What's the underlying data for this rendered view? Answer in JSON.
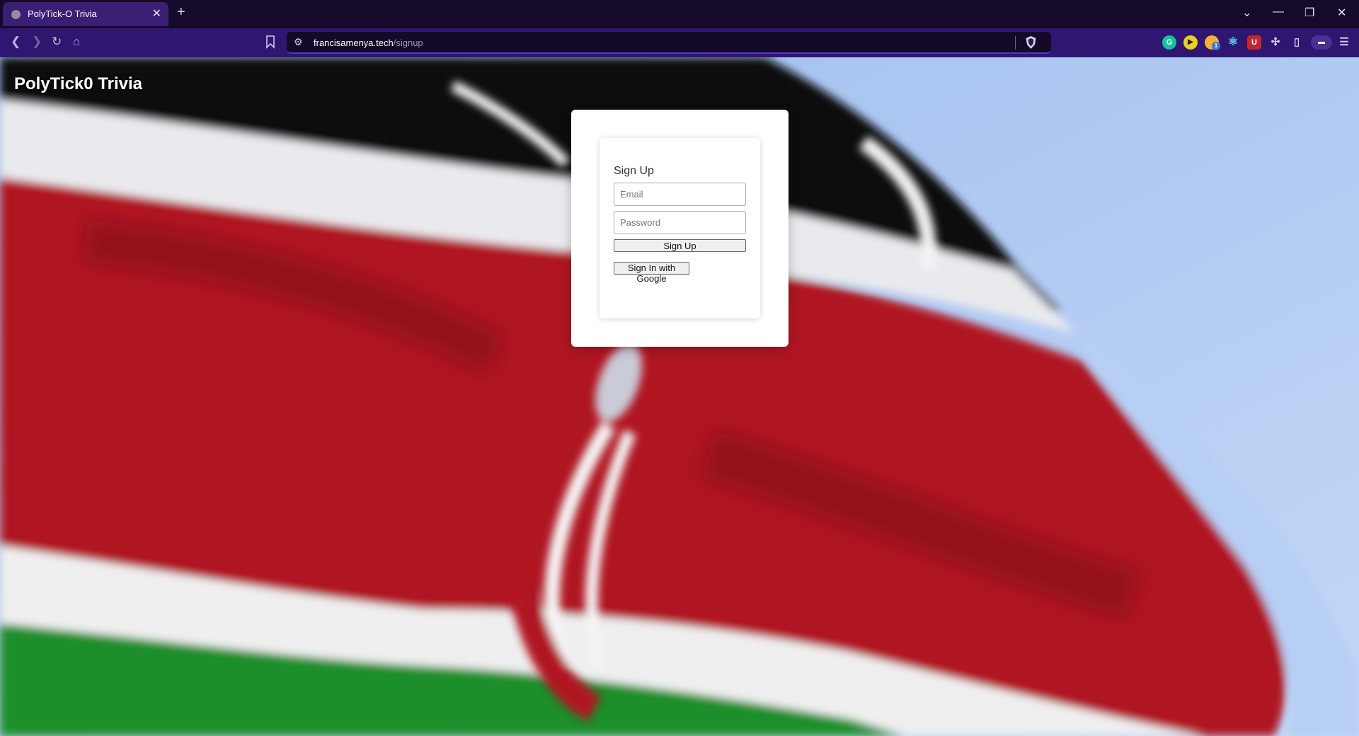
{
  "browser": {
    "tab_title": "PolyTick-O Trivia",
    "url_domain": "francisamenya.tech",
    "url_path": "/signup",
    "extensions": [
      {
        "name": "grammarly-icon",
        "glyph": "G",
        "color": "#15c39a"
      },
      {
        "name": "player-icon",
        "glyph": "▶",
        "color": "#e8d21d"
      },
      {
        "name": "notification-extension-icon",
        "glyph": "",
        "color": "#f2b233",
        "badge": "1"
      },
      {
        "name": "react-devtools-icon",
        "glyph": "⚛",
        "color": "transparent"
      },
      {
        "name": "ublock-icon",
        "glyph": "U",
        "color": "#c2262e"
      }
    ]
  },
  "page": {
    "brand": "PolyTick0 Trivia",
    "form": {
      "title": "Sign Up",
      "email_placeholder": "Email",
      "password_placeholder": "Password",
      "submit_label": "Sign Up",
      "google_label": "Sign In with Google"
    }
  },
  "colors": {
    "flag_black": "#0c0c10",
    "flag_red": "#b5101e",
    "flag_green": "#1f8f2c",
    "flag_white": "#f4f4f4",
    "sky": "#aac6f2"
  }
}
